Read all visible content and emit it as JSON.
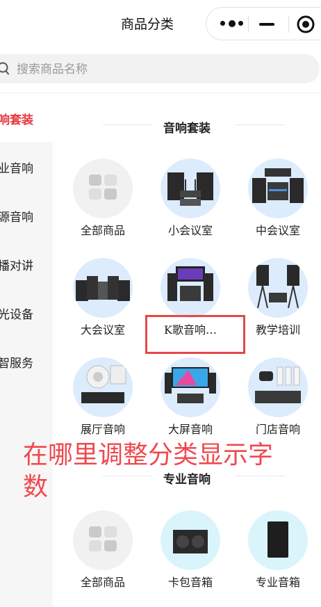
{
  "header": {
    "title": "商品分类",
    "menu_icon": "more-dots-icon",
    "minimize_icon": "minus-icon",
    "close_icon": "target-circle-icon"
  },
  "search": {
    "placeholder": "搜索商品名称",
    "icon": "search-icon"
  },
  "sidebar": {
    "items": [
      {
        "label": "响套装",
        "active": true
      },
      {
        "label": "业音响",
        "active": false
      },
      {
        "label": "源音响",
        "active": false
      },
      {
        "label": "播对讲",
        "active": false
      },
      {
        "label": "光设备",
        "active": false
      },
      {
        "label": "智服务",
        "active": false
      }
    ]
  },
  "sections": [
    {
      "title": "音响套装",
      "items": [
        {
          "label": "全部商品",
          "icon": "all-products-grid-icon"
        },
        {
          "label": "小会议室",
          "icon": "small-meeting-room-speakers-image"
        },
        {
          "label": "中会议室",
          "icon": "medium-meeting-room-speakers-image"
        },
        {
          "label": "大会议室",
          "icon": "large-meeting-room-speakers-image"
        },
        {
          "label": "K歌音响…",
          "icon": "karaoke-system-image"
        },
        {
          "label": "教学培训",
          "icon": "training-speakers-image"
        },
        {
          "label": "展厅音响",
          "icon": "exhibition-hall-speakers-image"
        },
        {
          "label": "大屏音响",
          "icon": "big-screen-speakers-image"
        },
        {
          "label": "门店音响",
          "icon": "store-speakers-image"
        }
      ]
    },
    {
      "title": "专业音响",
      "items": [
        {
          "label": "全部商品",
          "icon": "all-products-grid-icon"
        },
        {
          "label": "卡包音箱",
          "icon": "karaoke-box-speaker-image"
        },
        {
          "label": "专业音箱",
          "icon": "pro-speaker-image"
        }
      ]
    }
  ],
  "annotation": {
    "text": "在哪里调整分类显示字数",
    "color": "#f0484e"
  },
  "colors": {
    "accent": "#e8383d",
    "circle_blue": "#dcecfd",
    "sidebar_bg": "#f6f6f6"
  }
}
